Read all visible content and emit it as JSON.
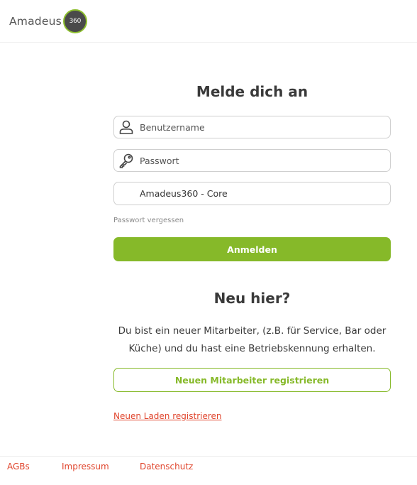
{
  "header": {
    "logo_text": "Amadeus",
    "logo_badge": "360"
  },
  "login": {
    "title": "Melde dich an",
    "username_placeholder": "Benutzername",
    "password_placeholder": "Passwort",
    "system_value": "Amadeus360 - Core",
    "forgot_password": "Passwort vergessen",
    "submit_label": "Anmelden"
  },
  "register": {
    "title": "Neu hier?",
    "description": "Du bist ein neuer Mitarbeiter, (z.B. für Service, Bar oder Küche) und du hast eine Betriebskennung erhalten.",
    "employee_button": "Neuen Mitarbeiter registrieren",
    "store_link": "Neuen Laden registrieren"
  },
  "footer": {
    "links": [
      "AGBs",
      "Impressum",
      "Datenschutz"
    ]
  },
  "colors": {
    "accent": "#86b929",
    "link": "#e0452d",
    "text": "#3a3a3a",
    "border": "#cfcfcf"
  },
  "icons": {
    "username": "user-icon",
    "password": "key-icon"
  }
}
